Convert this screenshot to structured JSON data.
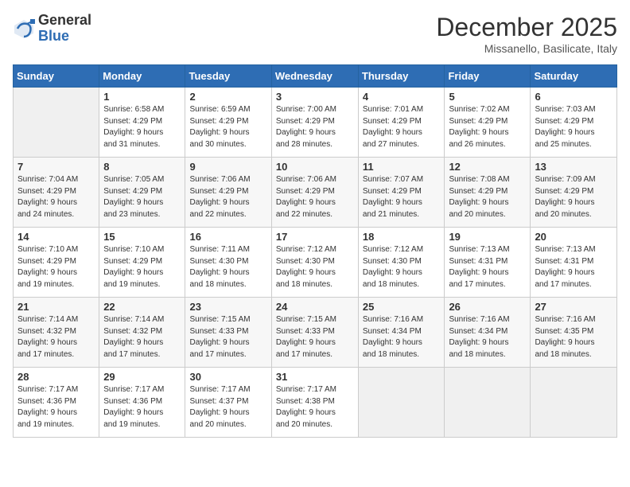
{
  "logo": {
    "general": "General",
    "blue": "Blue"
  },
  "header": {
    "month": "December 2025",
    "location": "Missanello, Basilicate, Italy"
  },
  "days_of_week": [
    "Sunday",
    "Monday",
    "Tuesday",
    "Wednesday",
    "Thursday",
    "Friday",
    "Saturday"
  ],
  "weeks": [
    [
      {
        "day": "",
        "info": ""
      },
      {
        "day": "1",
        "info": "Sunrise: 6:58 AM\nSunset: 4:29 PM\nDaylight: 9 hours\nand 31 minutes."
      },
      {
        "day": "2",
        "info": "Sunrise: 6:59 AM\nSunset: 4:29 PM\nDaylight: 9 hours\nand 30 minutes."
      },
      {
        "day": "3",
        "info": "Sunrise: 7:00 AM\nSunset: 4:29 PM\nDaylight: 9 hours\nand 28 minutes."
      },
      {
        "day": "4",
        "info": "Sunrise: 7:01 AM\nSunset: 4:29 PM\nDaylight: 9 hours\nand 27 minutes."
      },
      {
        "day": "5",
        "info": "Sunrise: 7:02 AM\nSunset: 4:29 PM\nDaylight: 9 hours\nand 26 minutes."
      },
      {
        "day": "6",
        "info": "Sunrise: 7:03 AM\nSunset: 4:29 PM\nDaylight: 9 hours\nand 25 minutes."
      }
    ],
    [
      {
        "day": "7",
        "info": "Sunrise: 7:04 AM\nSunset: 4:29 PM\nDaylight: 9 hours\nand 24 minutes."
      },
      {
        "day": "8",
        "info": "Sunrise: 7:05 AM\nSunset: 4:29 PM\nDaylight: 9 hours\nand 23 minutes."
      },
      {
        "day": "9",
        "info": "Sunrise: 7:06 AM\nSunset: 4:29 PM\nDaylight: 9 hours\nand 22 minutes."
      },
      {
        "day": "10",
        "info": "Sunrise: 7:06 AM\nSunset: 4:29 PM\nDaylight: 9 hours\nand 22 minutes."
      },
      {
        "day": "11",
        "info": "Sunrise: 7:07 AM\nSunset: 4:29 PM\nDaylight: 9 hours\nand 21 minutes."
      },
      {
        "day": "12",
        "info": "Sunrise: 7:08 AM\nSunset: 4:29 PM\nDaylight: 9 hours\nand 20 minutes."
      },
      {
        "day": "13",
        "info": "Sunrise: 7:09 AM\nSunset: 4:29 PM\nDaylight: 9 hours\nand 20 minutes."
      }
    ],
    [
      {
        "day": "14",
        "info": "Sunrise: 7:10 AM\nSunset: 4:29 PM\nDaylight: 9 hours\nand 19 minutes."
      },
      {
        "day": "15",
        "info": "Sunrise: 7:10 AM\nSunset: 4:29 PM\nDaylight: 9 hours\nand 19 minutes."
      },
      {
        "day": "16",
        "info": "Sunrise: 7:11 AM\nSunset: 4:30 PM\nDaylight: 9 hours\nand 18 minutes."
      },
      {
        "day": "17",
        "info": "Sunrise: 7:12 AM\nSunset: 4:30 PM\nDaylight: 9 hours\nand 18 minutes."
      },
      {
        "day": "18",
        "info": "Sunrise: 7:12 AM\nSunset: 4:30 PM\nDaylight: 9 hours\nand 18 minutes."
      },
      {
        "day": "19",
        "info": "Sunrise: 7:13 AM\nSunset: 4:31 PM\nDaylight: 9 hours\nand 17 minutes."
      },
      {
        "day": "20",
        "info": "Sunrise: 7:13 AM\nSunset: 4:31 PM\nDaylight: 9 hours\nand 17 minutes."
      }
    ],
    [
      {
        "day": "21",
        "info": "Sunrise: 7:14 AM\nSunset: 4:32 PM\nDaylight: 9 hours\nand 17 minutes."
      },
      {
        "day": "22",
        "info": "Sunrise: 7:14 AM\nSunset: 4:32 PM\nDaylight: 9 hours\nand 17 minutes."
      },
      {
        "day": "23",
        "info": "Sunrise: 7:15 AM\nSunset: 4:33 PM\nDaylight: 9 hours\nand 17 minutes."
      },
      {
        "day": "24",
        "info": "Sunrise: 7:15 AM\nSunset: 4:33 PM\nDaylight: 9 hours\nand 17 minutes."
      },
      {
        "day": "25",
        "info": "Sunrise: 7:16 AM\nSunset: 4:34 PM\nDaylight: 9 hours\nand 18 minutes."
      },
      {
        "day": "26",
        "info": "Sunrise: 7:16 AM\nSunset: 4:34 PM\nDaylight: 9 hours\nand 18 minutes."
      },
      {
        "day": "27",
        "info": "Sunrise: 7:16 AM\nSunset: 4:35 PM\nDaylight: 9 hours\nand 18 minutes."
      }
    ],
    [
      {
        "day": "28",
        "info": "Sunrise: 7:17 AM\nSunset: 4:36 PM\nDaylight: 9 hours\nand 19 minutes."
      },
      {
        "day": "29",
        "info": "Sunrise: 7:17 AM\nSunset: 4:36 PM\nDaylight: 9 hours\nand 19 minutes."
      },
      {
        "day": "30",
        "info": "Sunrise: 7:17 AM\nSunset: 4:37 PM\nDaylight: 9 hours\nand 20 minutes."
      },
      {
        "day": "31",
        "info": "Sunrise: 7:17 AM\nSunset: 4:38 PM\nDaylight: 9 hours\nand 20 minutes."
      },
      {
        "day": "",
        "info": ""
      },
      {
        "day": "",
        "info": ""
      },
      {
        "day": "",
        "info": ""
      }
    ]
  ]
}
